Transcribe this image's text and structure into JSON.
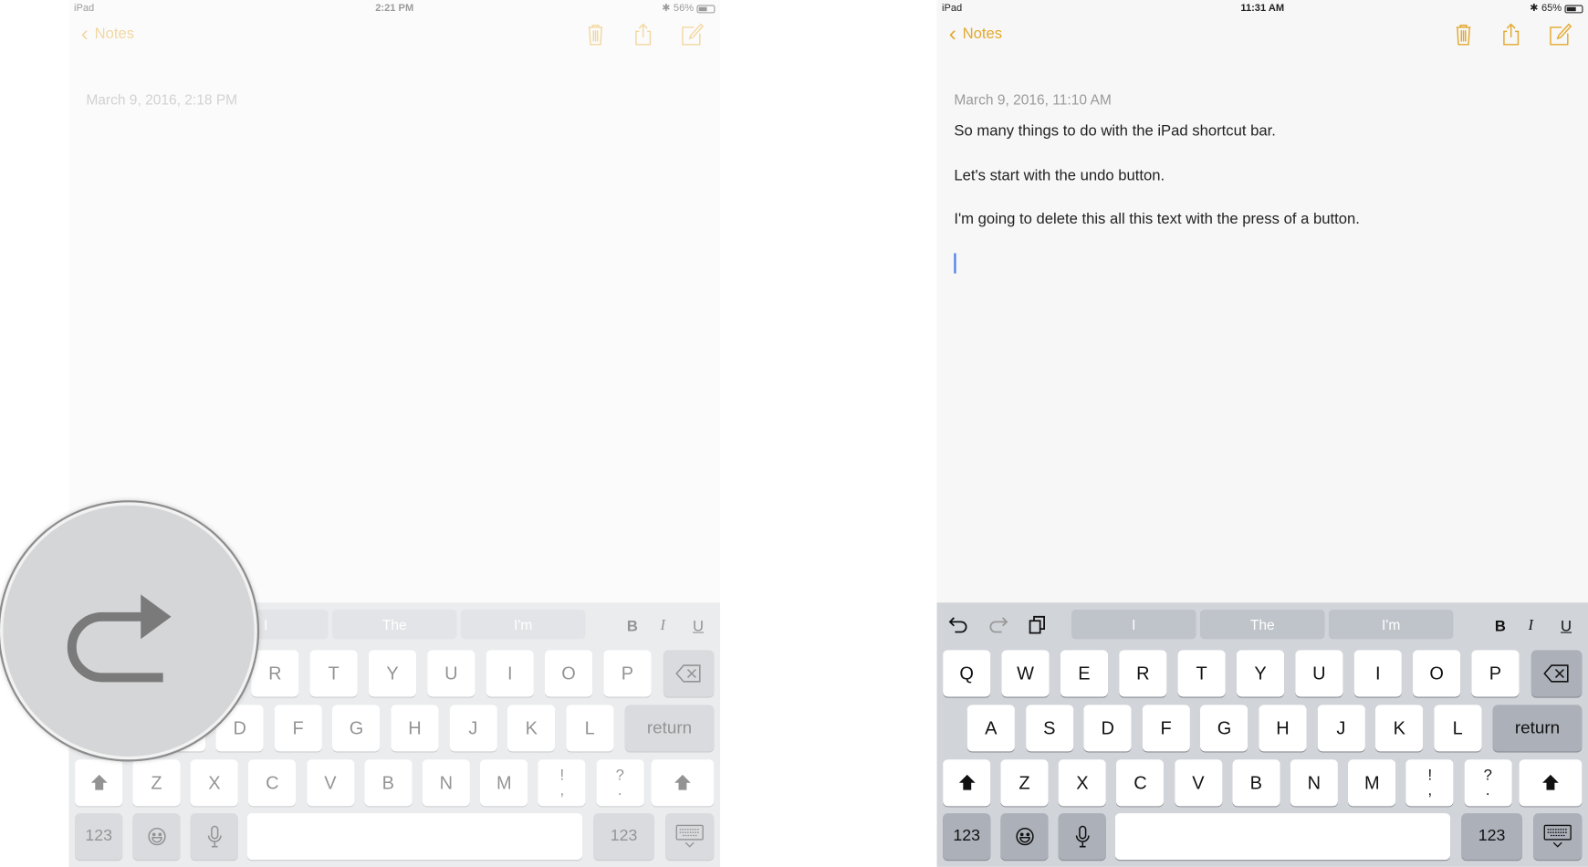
{
  "accent": "#e3a92f",
  "left": {
    "status": {
      "carrier": "iPad",
      "time": "2:21 PM",
      "battery": "56%",
      "battery_level": 0.56
    },
    "nav": {
      "back_label": "Notes"
    },
    "note": {
      "date": "March 9, 2016, 2:18 PM",
      "lines": []
    },
    "magnifier_icon": "redo-arrow-icon"
  },
  "right": {
    "status": {
      "carrier": "iPad",
      "time": "11:31 AM",
      "battery": "65%",
      "battery_level": 0.65
    },
    "nav": {
      "back_label": "Notes"
    },
    "note": {
      "date": "March 9, 2016, 11:10 AM",
      "lines": [
        "So many things to do with the iPad shortcut bar.",
        "Let's start with the undo button.",
        "I'm going to delete this all this text with the press of a button."
      ]
    }
  },
  "keyboard": {
    "suggestions": [
      "I",
      "The",
      "I'm"
    ],
    "format": [
      "B",
      "I",
      "U"
    ],
    "row1": [
      "Q",
      "W",
      "E",
      "R",
      "T",
      "Y",
      "U",
      "I",
      "O",
      "P"
    ],
    "row2": [
      "A",
      "S",
      "D",
      "F",
      "G",
      "H",
      "J",
      "K",
      "L"
    ],
    "row3": [
      "Z",
      "X",
      "C",
      "V",
      "B",
      "N",
      "M",
      "!\n,",
      "?\n."
    ],
    "return_label": "return",
    "numbers_label": "123"
  }
}
